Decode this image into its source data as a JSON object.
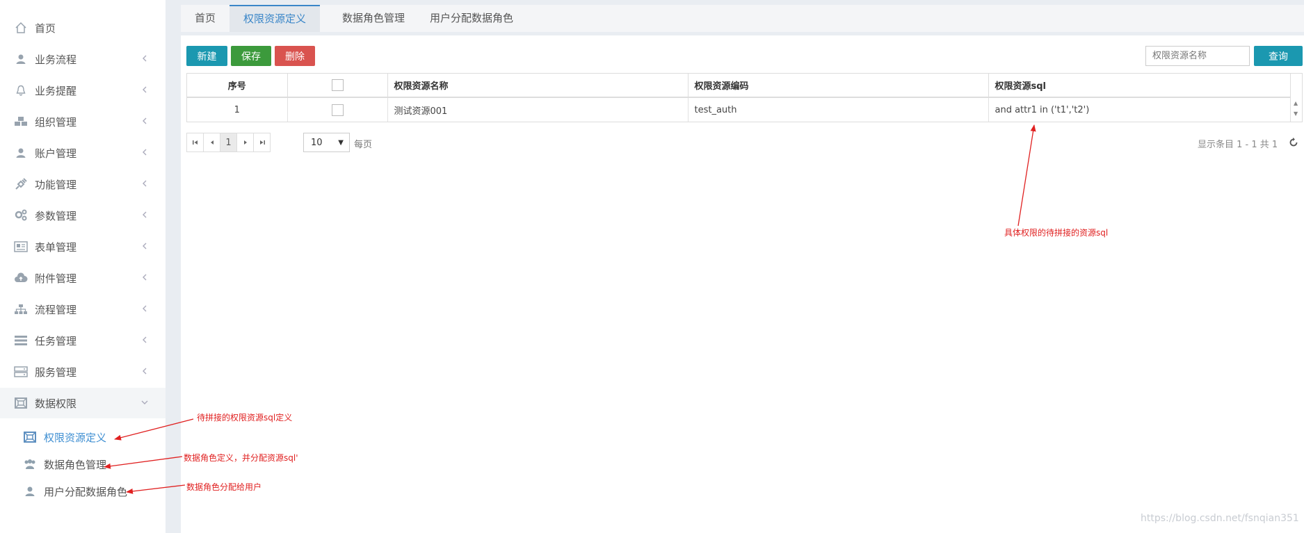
{
  "sidebar": {
    "items": [
      {
        "label": "首页",
        "icon": "home-icon"
      },
      {
        "label": "业务流程",
        "icon": "user-icon"
      },
      {
        "label": "业务提醒",
        "icon": "bell-icon"
      },
      {
        "label": "组织管理",
        "icon": "cubes-icon"
      },
      {
        "label": "账户管理",
        "icon": "user-icon"
      },
      {
        "label": "功能管理",
        "icon": "plug-icon"
      },
      {
        "label": "参数管理",
        "icon": "gears-icon"
      },
      {
        "label": "表单管理",
        "icon": "form-icon"
      },
      {
        "label": "附件管理",
        "icon": "cloud-upload-icon"
      },
      {
        "label": "流程管理",
        "icon": "sitemap-icon"
      },
      {
        "label": "任务管理",
        "icon": "tasks-icon"
      },
      {
        "label": "服务管理",
        "icon": "server-icon"
      },
      {
        "label": "数据权限",
        "icon": "data-scope-icon"
      }
    ],
    "sub_items": [
      {
        "label": "权限资源定义",
        "icon": "data-scope-icon"
      },
      {
        "label": "数据角色管理",
        "icon": "users-icon"
      },
      {
        "label": "用户分配数据角色",
        "icon": "user-icon"
      }
    ]
  },
  "tabs": [
    "首页",
    "权限资源定义",
    "数据角色管理",
    "用户分配数据角色"
  ],
  "toolbar": {
    "new_label": "新建",
    "save_label": "保存",
    "delete_label": "删除",
    "search_placeholder": "权限资源名称",
    "query_label": "查询"
  },
  "table": {
    "columns": [
      "序号",
      "",
      "权限资源名称",
      "权限资源编码",
      "权限资源sql"
    ],
    "rows": [
      {
        "index": "1",
        "name": "测试资源001",
        "code": "test_auth",
        "sql": "and attr1 in ('t1','t2')"
      }
    ]
  },
  "pager": {
    "current_page": "1",
    "page_size": "10",
    "per_page_label": "每页",
    "info": "显示条目 1 - 1 共 1"
  },
  "annotations": {
    "sql_note": "具体权限的待拼接的资源sql",
    "resource_note": "待拼接的权限资源sql定义",
    "role_note": "数据角色定义，并分配资源sql'",
    "assign_note": "数据角色分配给用户"
  },
  "watermark": "https://blog.csdn.net/fsnqian351",
  "colors": {
    "primary": "#1b98b0",
    "success": "#3c9a3c",
    "danger": "#d9534f",
    "active_tab": "#3a86c8",
    "annotation": "#e02020"
  }
}
